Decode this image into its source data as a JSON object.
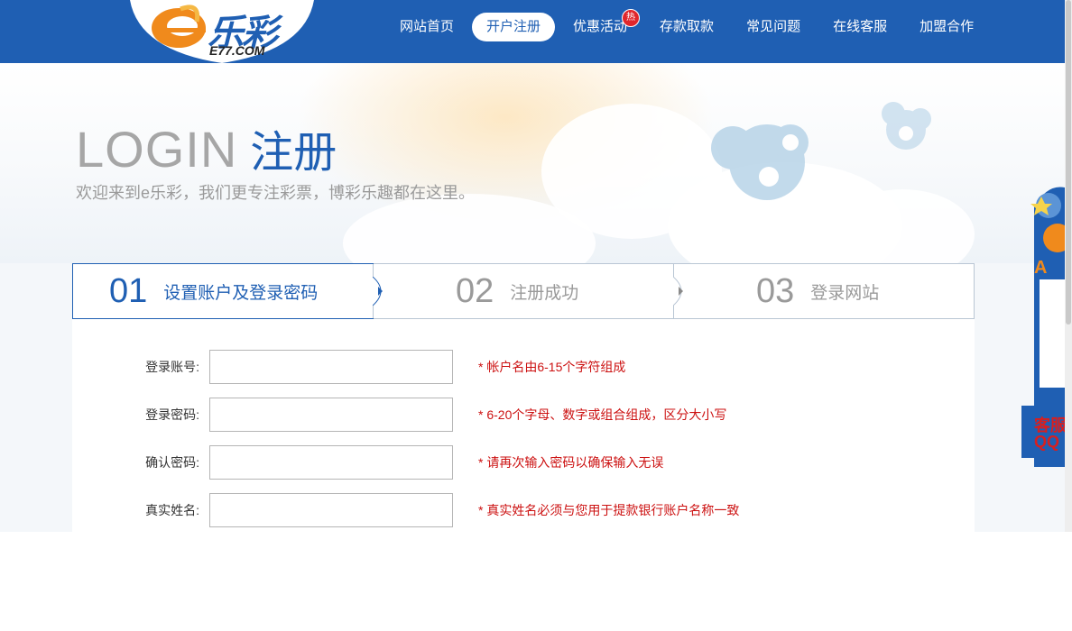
{
  "logo": {
    "brand_text": "乐彩",
    "domain_text": "E77.COM"
  },
  "nav": {
    "items": [
      {
        "label": "网站首页",
        "active": false
      },
      {
        "label": "开户注册",
        "active": true
      },
      {
        "label": "优惠活动",
        "active": false,
        "badge": "热"
      },
      {
        "label": "存款取款",
        "active": false
      },
      {
        "label": "常见问题",
        "active": false
      },
      {
        "label": "在线客服",
        "active": false
      },
      {
        "label": "加盟合作",
        "active": false
      }
    ]
  },
  "hero": {
    "title_en": "LOGIN",
    "title_cn": "注册",
    "tagline": "欢迎来到e乐彩，我们更专注彩票，博彩乐趣都在这里。"
  },
  "steps": [
    {
      "num": "01",
      "label": "设置账户及登录密码",
      "active": true
    },
    {
      "num": "02",
      "label": "注册成功",
      "active": false
    },
    {
      "num": "03",
      "label": "登录网站",
      "active": false
    }
  ],
  "form": {
    "fields": [
      {
        "label": "登录账号:",
        "value": "",
        "hint": "* 帐户名由6-15个字符组成"
      },
      {
        "label": "登录密码:",
        "value": "",
        "hint": "* 6-20个字母、数字或组合组成，区分大小写"
      },
      {
        "label": "确认密码:",
        "value": "",
        "hint": "* 请再次输入密码以确保输入无误"
      },
      {
        "label": "真实姓名:",
        "value": "",
        "hint": "* 真实姓名必须与您用于提款银行账户名称一致"
      }
    ]
  },
  "side_widget": {
    "line1": "A",
    "line2": "客服",
    "line3": "QQ"
  },
  "colors": {
    "primary": "#1f5fb3",
    "hint_red": "#cc1111",
    "hot_red": "#e0262b",
    "logo_orange": "#f08a1c"
  }
}
